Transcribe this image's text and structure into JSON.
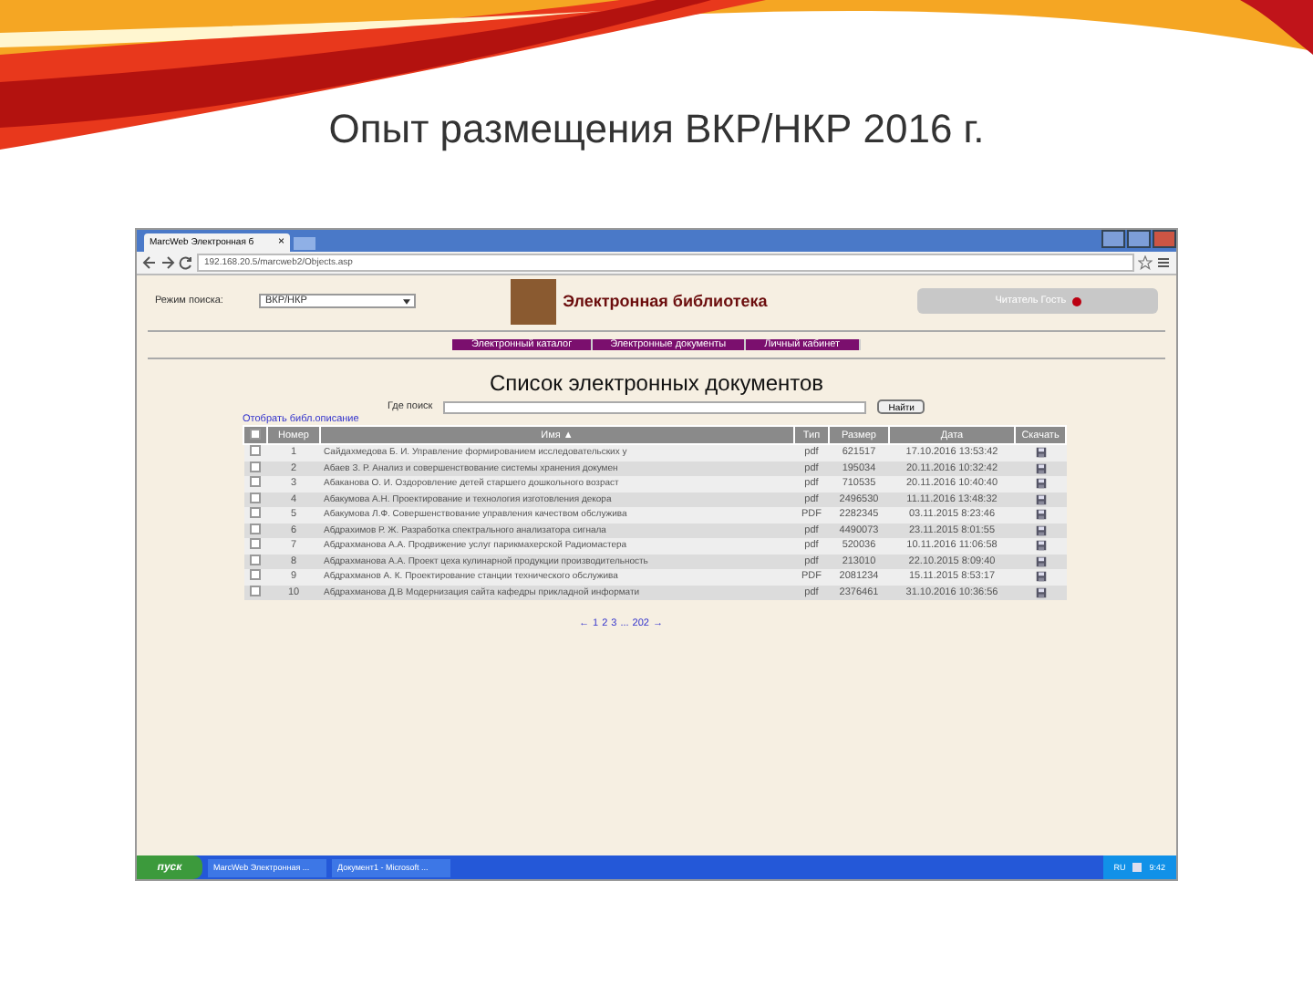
{
  "slide": {
    "title": "Опыт размещения ВКР/НКР 2016 г."
  },
  "browser": {
    "tab_title": "MarcWeb Электронная б",
    "tab_close": "×",
    "address": "192.168.20.5/marcweb2/Objects.asp"
  },
  "page": {
    "mode_label": "Режим поиска:",
    "mode_value": "ВКР/НКР",
    "site_title": "Электронная библиотека",
    "reader_button": "Читатель Гость",
    "nav": [
      "Электронный каталог",
      "Электронные документы",
      "Личный кабинет"
    ],
    "heading": "Список электронных документов",
    "search_label": "Где поиск",
    "search_button": "Найти",
    "select_link": "Отобрать библ.описание",
    "select_all_checked": false,
    "columns": [
      "Номер",
      "Имя ▲",
      "Тип",
      "Размер",
      "Дата",
      "Скачать"
    ],
    "rows": [
      {
        "checked": false,
        "cells": [
          "1",
          "Сайдахмедова Б. И. Управление формированием исследовательских у",
          "pdf",
          "621517",
          "17.10.2016 13:53:42"
        ]
      },
      {
        "checked": false,
        "cells": [
          "2",
          "Абаев З. Р. Анализ и совершенствование системы хранения докумен",
          "pdf",
          "195034",
          "20.11.2016 10:32:42"
        ]
      },
      {
        "checked": false,
        "cells": [
          "3",
          "Абаканова О. И. Оздоровление детей старшего дошкольного возраст",
          "pdf",
          "710535",
          "20.11.2016 10:40:40"
        ]
      },
      {
        "checked": false,
        "cells": [
          "4",
          "Абакумова А.Н. Проектирование и технология изготовления декора",
          "pdf",
          "2496530",
          "11.11.2016 13:48:32"
        ]
      },
      {
        "checked": false,
        "cells": [
          "5",
          "Абакумова Л.Ф. Совершенствование управления качеством обслужива",
          "PDF",
          "2282345",
          "03.11.2015 8:23:46"
        ]
      },
      {
        "checked": false,
        "cells": [
          "6",
          "Абдрахимов Р. Ж. Разработка спектрального анализатора сигнала",
          "pdf",
          "4490073",
          "23.11.2015 8:01:55"
        ]
      },
      {
        "checked": false,
        "cells": [
          "7",
          "Абдрахманова А.А. Продвижение услуг парикмахерской Радиомастера",
          "pdf",
          "520036",
          "10.11.2016 11:06:58"
        ]
      },
      {
        "checked": false,
        "cells": [
          "8",
          "Абдрахманова А.А. Проект цеха кулинарной продукции производительность",
          "pdf",
          "213010",
          "22.10.2015 8:09:40"
        ]
      },
      {
        "checked": false,
        "cells": [
          "9",
          "Абдрахманов А. К. Проектирование станции технического обслужива",
          "PDF",
          "2081234",
          "15.11.2015 8:53:17"
        ]
      },
      {
        "checked": false,
        "cells": [
          "10",
          "Абдрахманова Д.В Модернизация сайта кафедры прикладной информати",
          "pdf",
          "2376461",
          "31.10.2016 10:36:56"
        ]
      }
    ],
    "pagination": [
      "←",
      "1",
      "2",
      "3",
      "...",
      "202",
      "→"
    ]
  },
  "taskbar": {
    "start": "пуск",
    "items": [
      "MarcWeb Электронная ...",
      "Документ1 - Microsoft ..."
    ],
    "lang": "RU",
    "clock": "9:42"
  }
}
